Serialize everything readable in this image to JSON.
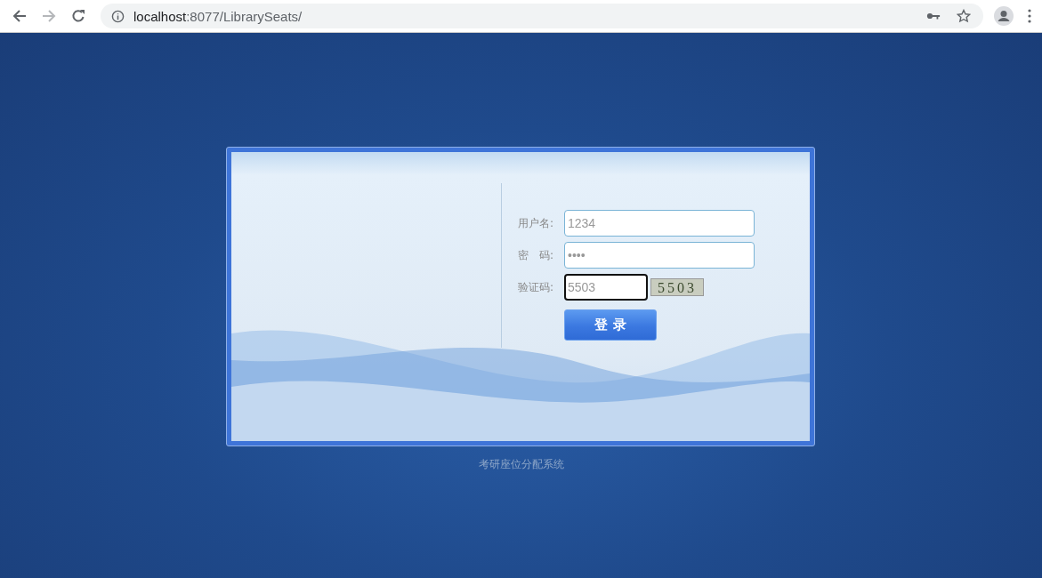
{
  "browser": {
    "back_disabled": false,
    "forward_disabled": true,
    "url_host": "localhost",
    "url_path": ":8077/LibrarySeats/"
  },
  "login": {
    "fields": [
      {
        "label": "用户名:",
        "value": "1234",
        "focused": false
      },
      {
        "label": "密　码:",
        "value": "••••",
        "focused": false
      },
      {
        "label": "验证码:",
        "value": "5503",
        "focused": true
      }
    ],
    "captcha": "5503",
    "button": "登 录"
  },
  "footer": "考研座位分配系统"
}
